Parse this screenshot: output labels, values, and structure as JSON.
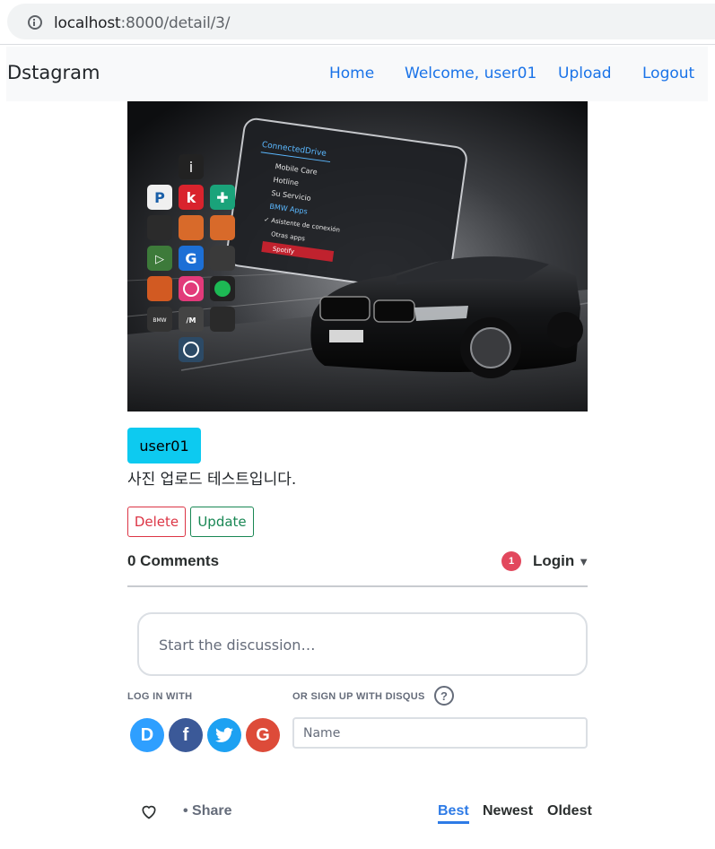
{
  "browser": {
    "url_host": "localhost",
    "url_path": ":8000/detail/3/"
  },
  "navbar": {
    "brand": "Dstagram",
    "links": [
      "Home",
      "Welcome, user01",
      "Upload",
      "Logout"
    ]
  },
  "post": {
    "username": "user01",
    "caption": "사진 업로드 테스트입니다.",
    "delete_label": "Delete",
    "update_label": "Update",
    "image": {
      "screen_brand": "ConnectedDrive",
      "menu_items": [
        "Mobile Care",
        "Hotline",
        "Su Servicio",
        "BMW Apps",
        "✓ Asistente de conexión",
        "Otras apps",
        "Spotify"
      ]
    }
  },
  "disqus": {
    "comments_count": "0 Comments",
    "notification_count": "1",
    "login_label": "Login",
    "discussion_placeholder": "Start the discussion…",
    "login_with_label": "LOG IN WITH",
    "signup_label": "OR SIGN UP WITH DISQUS",
    "help_symbol": "?",
    "name_placeholder": "Name",
    "social": [
      "D",
      "f",
      "t",
      "G"
    ],
    "share_label": "Share",
    "sort": [
      "Best",
      "Newest",
      "Oldest"
    ]
  },
  "colors": {
    "link_blue": "#1a73e8",
    "badge_cyan": "#0dcaf0",
    "delete_red": "#dc3545",
    "update_green": "#198754",
    "disqus_blue": "#2e9fff",
    "facebook": "#3b5998",
    "twitter": "#1da1f2",
    "google": "#dd4b39",
    "notification_red": "#e2485d"
  }
}
